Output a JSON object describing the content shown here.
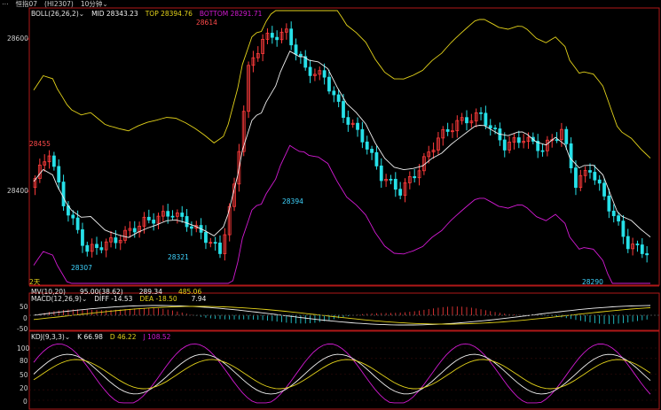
{
  "top_bar": {
    "symbol": "恒指07",
    "code": "(HI2307)",
    "period": "10分钟",
    "menu_icon": "menu-icon",
    "dropdown_icon": "chevron-down-icon"
  },
  "main_panel": {
    "indicator_name": "BOLL(26,26,2)",
    "mid_text": "MID 28343.23",
    "top_text": "TOP 28394.76",
    "bottom_text": "BOTTOM 28291.71",
    "y_labels": [
      "28600",
      "28400"
    ],
    "annotations": [
      {
        "text": "28614",
        "color": "#ff4a4a"
      },
      {
        "text": "28455",
        "color": "#ff4a4a"
      },
      {
        "text": "28394",
        "color": "#3fd4ff"
      },
      {
        "text": "28321",
        "color": "#3fd4ff"
      },
      {
        "text": "28307",
        "color": "#3fd4ff"
      },
      {
        "text": "28290",
        "color": "#3fd4ff"
      }
    ],
    "days_label": "2天",
    "colors": {
      "up": "#ff3b3b",
      "down": "#27e0e8",
      "mid": "#f0f0f0",
      "upper": "#e3d21a",
      "lower": "#d21ad2"
    }
  },
  "volume_panel": {
    "indicator_name": "MV(10,20)",
    "v1": "95.00(38.62)",
    "v2": "289.34",
    "v3": "485.06"
  },
  "macd_panel": {
    "indicator_name": "MACD(12,26,9)",
    "diff_text": "DIFF -14.53",
    "dea_text": "DEA -18.50",
    "macd_value": "7.94",
    "y_labels": [
      "50",
      "0",
      "-50"
    ]
  },
  "kdj_panel": {
    "indicator_name": "KDJ(9,3,3)",
    "k_text": "K 66.98",
    "d_text": "D 46.22",
    "j_text": "J 108.52",
    "y_labels": [
      "100",
      "80",
      "50",
      "20",
      "0"
    ]
  }
}
